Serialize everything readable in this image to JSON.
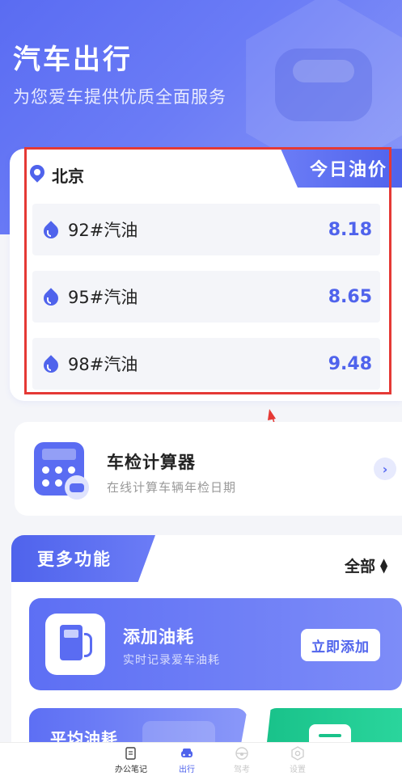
{
  "header": {
    "title": "汽车出行",
    "subtitle": "为您爱车提供优质全面服务"
  },
  "oil_prices": {
    "tag": "今日油价",
    "city": "北京",
    "items": [
      {
        "name": "92#汽油",
        "price": "8.18"
      },
      {
        "name": "95#汽油",
        "price": "8.65"
      },
      {
        "name": "98#汽油",
        "price": "9.48"
      }
    ]
  },
  "calculator": {
    "title": "车检计算器",
    "subtitle": "在线计算车辆年检日期"
  },
  "more": {
    "tab_label": "更多功能",
    "filter_label": "全部",
    "fuel": {
      "title": "添加油耗",
      "subtitle": "实时记录爱车油耗",
      "button": "立即添加"
    },
    "avg": {
      "title": "平均油耗"
    }
  },
  "bottom_nav": [
    {
      "label": "办公笔记",
      "icon": "note-icon",
      "state": "normal"
    },
    {
      "label": "出行",
      "icon": "car-icon",
      "state": "active"
    },
    {
      "label": "驾考",
      "icon": "steering-wheel-icon",
      "state": "dim"
    },
    {
      "label": "设置",
      "icon": "gear-icon",
      "state": "dim"
    }
  ],
  "colors": {
    "accent": "#4f63ec",
    "annotation": "#e53935",
    "green": "#19c28a"
  }
}
